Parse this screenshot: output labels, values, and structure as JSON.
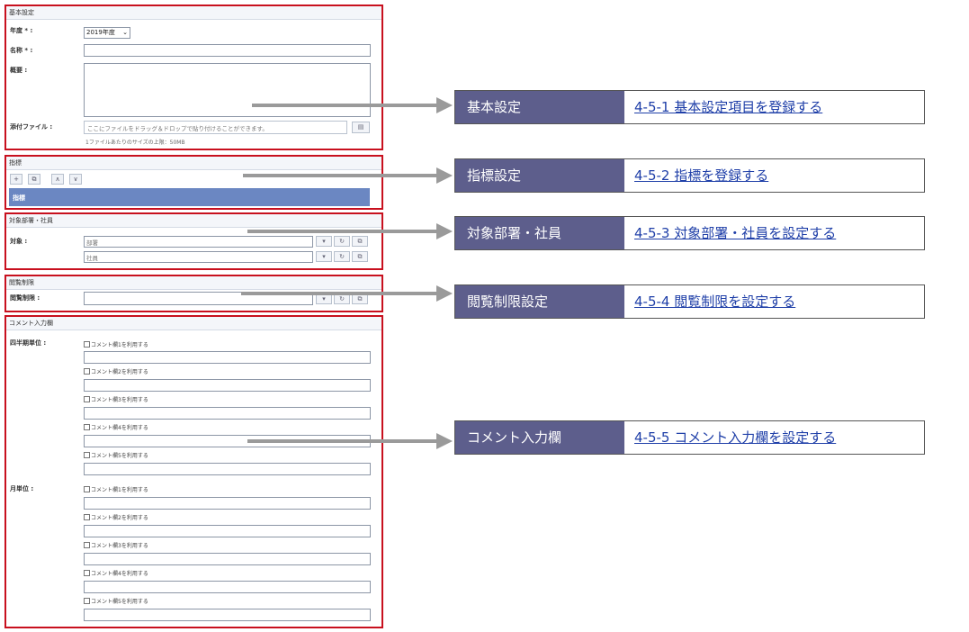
{
  "sections": {
    "basic": {
      "title": "基本設定",
      "year_label": "年度 * :",
      "year_value": "2019年度",
      "name_label": "名称 * :",
      "summary_label": "概要 :",
      "attachment_label": "添付ファイル :",
      "attachment_placeholder": "ここにファイルをドラッグ＆ドロップで貼り付けることができます。",
      "attachment_hint": "1ファイルあたりのサイズの上限：50MB"
    },
    "indicators": {
      "title": "指標",
      "header_label": "指標",
      "buttons": [
        "+",
        "⧉",
        "∧",
        "∨"
      ]
    },
    "targets": {
      "title": "対象部署・社員",
      "target_label": "対象 :",
      "dept_placeholder": "部署",
      "employee_placeholder": "社員"
    },
    "viewing": {
      "title": "閲覧制限",
      "label": "閲覧制限 :"
    },
    "comments": {
      "title": "コメント入力欄",
      "quarterly_label": "四半期単位 :",
      "monthly_label": "月単位 :",
      "quarterly_items": [
        "コメント欄1を利用する",
        "コメント欄2を利用する",
        "コメント欄3を利用する",
        "コメント欄4を利用する",
        "コメント欄5を利用する"
      ],
      "monthly_items": [
        "コメント欄1を利用する",
        "コメント欄2を利用する",
        "コメント欄3を利用する",
        "コメント欄4を利用する",
        "コメント欄5を利用する"
      ]
    }
  },
  "callouts": [
    {
      "category": "基本設定",
      "link": "4-5-1 基本設定項目を登録する"
    },
    {
      "category": "指標設定",
      "link": "4-5-2 指標を登録する"
    },
    {
      "category": "対象部署・社員",
      "link": "4-5-3 対象部署・社員を設定する"
    },
    {
      "category": "閲覧制限設定",
      "link": "4-5-4 閲覧制限を設定する"
    },
    {
      "category": "コメント入力欄",
      "link": "4-5-5 コメント入力欄を設定する"
    }
  ],
  "colors": {
    "highlight_border": "#c8101e",
    "callout_bg": "#5d5e8c",
    "link": "#1f3fa8",
    "arrow": "#9a9a9a"
  }
}
